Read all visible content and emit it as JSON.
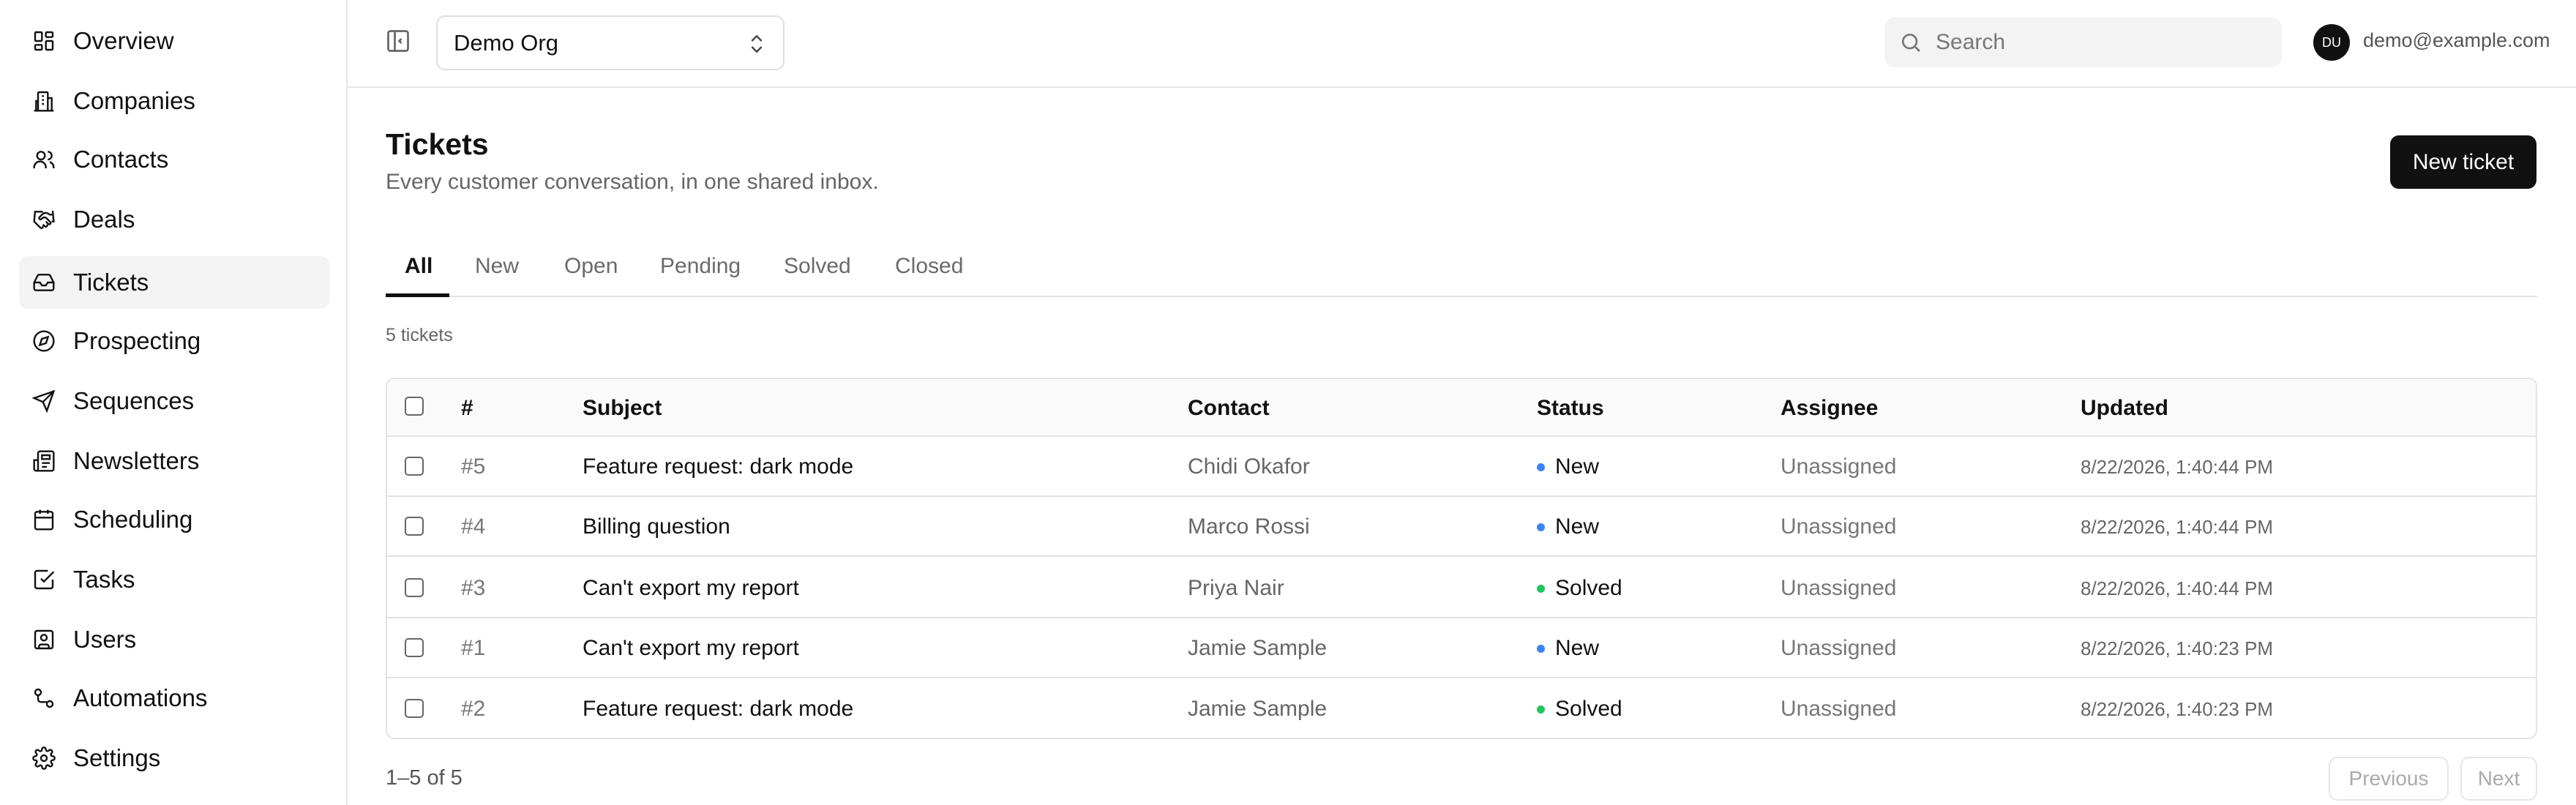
{
  "sidebar": {
    "items": [
      {
        "label": "Overview",
        "icon": "grid-icon",
        "active": false
      },
      {
        "label": "Companies",
        "icon": "building-icon",
        "active": false
      },
      {
        "label": "Contacts",
        "icon": "users-icon",
        "active": false
      },
      {
        "label": "Deals",
        "icon": "handshake-icon",
        "active": false
      },
      {
        "label": "Tickets",
        "icon": "inbox-icon",
        "active": true
      },
      {
        "label": "Prospecting",
        "icon": "compass-icon",
        "active": false
      },
      {
        "label": "Sequences",
        "icon": "send-icon",
        "active": false
      },
      {
        "label": "Newsletters",
        "icon": "newspaper-icon",
        "active": false
      },
      {
        "label": "Scheduling",
        "icon": "calendar-icon",
        "active": false
      },
      {
        "label": "Tasks",
        "icon": "checkbox-icon",
        "active": false
      },
      {
        "label": "Users",
        "icon": "user-square-icon",
        "active": false
      },
      {
        "label": "Automations",
        "icon": "workflow-icon",
        "active": false
      },
      {
        "label": "Settings",
        "icon": "gear-icon",
        "active": false
      }
    ]
  },
  "topbar": {
    "org_name": "Demo Org",
    "search_placeholder": "Search",
    "avatar_initials": "DU",
    "user_email": "demo@example.com"
  },
  "page": {
    "title": "Tickets",
    "subtitle": "Every customer conversation, in one shared inbox.",
    "new_ticket_label": "New ticket",
    "ticket_count": "5 tickets"
  },
  "tabs": [
    "All",
    "New",
    "Open",
    "Pending",
    "Solved",
    "Closed"
  ],
  "table": {
    "headers": [
      "#",
      "Subject",
      "Contact",
      "Status",
      "Assignee",
      "Updated"
    ],
    "rows": [
      {
        "num": "#5",
        "subject": "Feature request: dark mode",
        "contact": "Chidi Okafor",
        "status": "New",
        "assignee": "Unassigned",
        "updated": "8/22/2026, 1:40:44 PM"
      },
      {
        "num": "#4",
        "subject": "Billing question",
        "contact": "Marco Rossi",
        "status": "New",
        "assignee": "Unassigned",
        "updated": "8/22/2026, 1:40:44 PM"
      },
      {
        "num": "#3",
        "subject": "Can't export my report",
        "contact": "Priya Nair",
        "status": "Solved",
        "assignee": "Unassigned",
        "updated": "8/22/2026, 1:40:44 PM"
      },
      {
        "num": "#1",
        "subject": "Can't export my report",
        "contact": "Jamie Sample",
        "status": "New",
        "assignee": "Unassigned",
        "updated": "8/22/2026, 1:40:23 PM"
      },
      {
        "num": "#2",
        "subject": "Feature request: dark mode",
        "contact": "Jamie Sample",
        "status": "Solved",
        "assignee": "Unassigned",
        "updated": "8/22/2026, 1:40:23 PM"
      }
    ]
  },
  "pagination": {
    "range_label": "1–5 of 5",
    "previous_label": "Previous",
    "next_label": "Next"
  },
  "colors": {
    "status_new": "#3b82f6",
    "status_solved": "#22c55e",
    "primary": "#111111"
  }
}
